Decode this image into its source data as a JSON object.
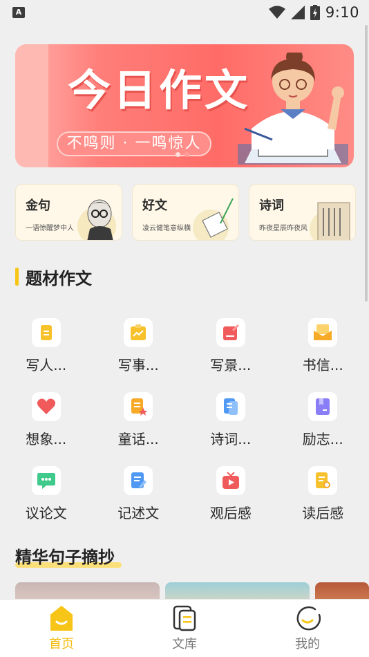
{
  "status_bar": {
    "time": "9:10",
    "left_badge": "A"
  },
  "banner": {
    "title": "今日作文",
    "slogan": "不鸣则 · 一鸣惊人"
  },
  "quick_cards": [
    {
      "title": "金句",
      "subtitle": "一语惊醒梦中人"
    },
    {
      "title": "好文",
      "subtitle": "凌云健笔意纵横"
    },
    {
      "title": "诗词",
      "subtitle": "昨夜星辰昨夜风"
    }
  ],
  "topic_section": {
    "title": "题材作文"
  },
  "topics": [
    {
      "label": "写人...",
      "icon": "document-icon",
      "color": "#f7c12c"
    },
    {
      "label": "写事...",
      "icon": "chart-board-icon",
      "color": "#f7c12c"
    },
    {
      "label": "写景...",
      "icon": "pencil-picture-icon",
      "color": "#f05a5a"
    },
    {
      "label": "书信...",
      "icon": "letter-icon",
      "color": "#f7a928"
    },
    {
      "label": "想象...",
      "icon": "heart-icon",
      "color": "#f05a5a"
    },
    {
      "label": "童话...",
      "icon": "star-book-icon",
      "color": "#f7a928"
    },
    {
      "label": "诗词...",
      "icon": "copy-doc-icon",
      "color": "#4f98f4"
    },
    {
      "label": "励志...",
      "icon": "bookmark-icon",
      "color": "#8a7ef6"
    },
    {
      "label": "议论文",
      "icon": "chat-icon",
      "color": "#3fc98a"
    },
    {
      "label": "记述文",
      "icon": "edit-doc-icon",
      "color": "#4f98f4"
    },
    {
      "label": "观后感",
      "icon": "tv-play-icon",
      "color": "#f05a5a"
    },
    {
      "label": "读后感",
      "icon": "search-doc-icon",
      "color": "#f7c12c"
    }
  ],
  "excerpt_section": {
    "title": "精华句子摘抄"
  },
  "tabs": [
    {
      "label": "首页",
      "icon": "home-icon",
      "active": true
    },
    {
      "label": "文库",
      "icon": "library-icon",
      "active": false
    },
    {
      "label": "我的",
      "icon": "profile-icon",
      "active": false
    }
  ]
}
